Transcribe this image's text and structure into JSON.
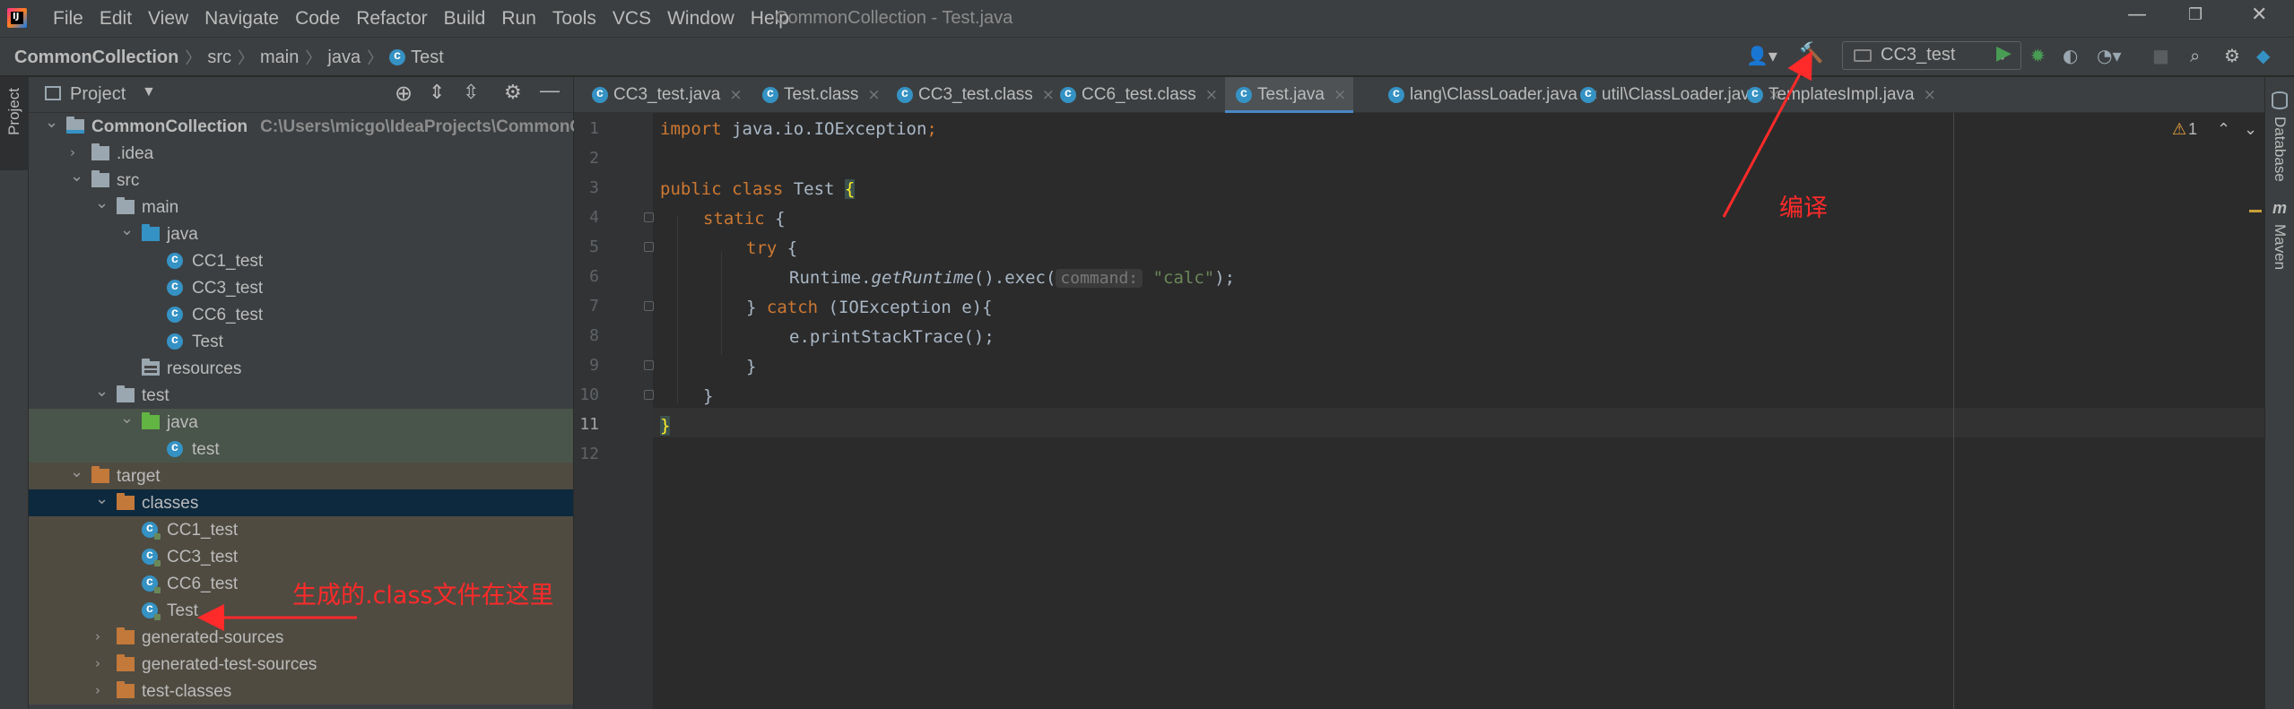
{
  "menubar": {
    "items": [
      "File",
      "Edit",
      "View",
      "Navigate",
      "Code",
      "Refactor",
      "Build",
      "Run",
      "Tools",
      "VCS",
      "Window",
      "Help"
    ],
    "window_title": "CommonCollection - Test.java"
  },
  "navbar": {
    "breadcrumbs": [
      "CommonCollection",
      "src",
      "main",
      "java",
      "Test"
    ],
    "run_config": "CC3_test"
  },
  "project_panel": {
    "title": "Project",
    "tree": [
      {
        "label": "CommonCollection",
        "path": "C:\\Users\\micgo\\IdeaProjects\\CommonCol",
        "icon": "module",
        "depth": 0,
        "expanded": true
      },
      {
        "label": ".idea",
        "icon": "folder-gray",
        "depth": 1,
        "expanded": false
      },
      {
        "label": "src",
        "icon": "folder-gray",
        "depth": 1,
        "expanded": true
      },
      {
        "label": "main",
        "icon": "folder-gray",
        "depth": 2,
        "expanded": true
      },
      {
        "label": "java",
        "icon": "folder-blue",
        "depth": 3,
        "expanded": true
      },
      {
        "label": "CC1_test",
        "icon": "class",
        "depth": 4
      },
      {
        "label": "CC3_test",
        "icon": "class",
        "depth": 4
      },
      {
        "label": "CC6_test",
        "icon": "class",
        "depth": 4
      },
      {
        "label": "Test",
        "icon": "class",
        "depth": 4
      },
      {
        "label": "resources",
        "icon": "folder-res",
        "depth": 3
      },
      {
        "label": "test",
        "icon": "folder-gray",
        "depth": 2,
        "expanded": true
      },
      {
        "label": "java",
        "icon": "folder-green",
        "depth": 3,
        "expanded": true,
        "bg": "green"
      },
      {
        "label": "test",
        "icon": "class",
        "depth": 4,
        "bg": "green"
      },
      {
        "label": "target",
        "icon": "folder-orange",
        "depth": 1,
        "expanded": true,
        "bg": "target"
      },
      {
        "label": "classes",
        "icon": "folder-orange",
        "depth": 2,
        "expanded": true,
        "bg": "selected"
      },
      {
        "label": "CC1_test",
        "icon": "class",
        "depth": 3,
        "bg": "target"
      },
      {
        "label": "CC3_test",
        "icon": "class",
        "depth": 3,
        "bg": "target"
      },
      {
        "label": "CC6_test",
        "icon": "class",
        "depth": 3,
        "bg": "target"
      },
      {
        "label": "Test",
        "icon": "class",
        "depth": 3,
        "bg": "target"
      },
      {
        "label": "generated-sources",
        "icon": "folder-orange",
        "depth": 2,
        "expanded": false,
        "bg": "target"
      },
      {
        "label": "generated-test-sources",
        "icon": "folder-orange",
        "depth": 2,
        "expanded": false,
        "bg": "target"
      },
      {
        "label": "test-classes",
        "icon": "folder-orange",
        "depth": 2,
        "expanded": false,
        "bg": "target"
      }
    ]
  },
  "editor": {
    "tabs": [
      {
        "label": "CC3_test.java",
        "active": false
      },
      {
        "label": "Test.class",
        "active": false
      },
      {
        "label": "CC3_test.class",
        "active": false
      },
      {
        "label": "CC6_test.class",
        "active": false
      },
      {
        "label": "Test.java",
        "active": true
      },
      {
        "label": "lang\\ClassLoader.java",
        "active": false
      },
      {
        "label": "util\\ClassLoader.java",
        "active": false
      },
      {
        "label": "TemplatesImpl.java",
        "active": false
      }
    ],
    "line_numbers": [
      "1",
      "2",
      "3",
      "4",
      "5",
      "6",
      "7",
      "8",
      "9",
      "10",
      "11",
      "12"
    ],
    "warning_count": "1",
    "code": {
      "l1_kw": "import",
      "l1_rest": " java.io.IOException",
      "l1_semi": ";",
      "l3_kw": "public class",
      "l3_name": " Test ",
      "l3_brace": "{",
      "l4_kw": "static",
      "l4_rest": " {",
      "l5_kw": "try",
      "l5_rest": " {",
      "l6_a": "Runtime.",
      "l6_method": "getRuntime",
      "l6_b": "().exec(",
      "l6_hint": "command:",
      "l6_str": "\"calc\"",
      "l6_end": ");",
      "l7_a": "} ",
      "l7_kw": "catch",
      "l7_b": " (IOException e){",
      "l8": "e.printStackTrace();",
      "l9": "}",
      "l10": "}",
      "l11": "}"
    }
  },
  "side_tools": {
    "left": "Project",
    "right": [
      "Database",
      "Maven"
    ]
  },
  "annotations": {
    "compile": "编译",
    "class_files": "生成的.class文件在这里"
  },
  "colors": {
    "accent_red": "#ff2a2a",
    "selection": "#0d293e",
    "keyword": "#cc7832",
    "string": "#6a8759"
  }
}
